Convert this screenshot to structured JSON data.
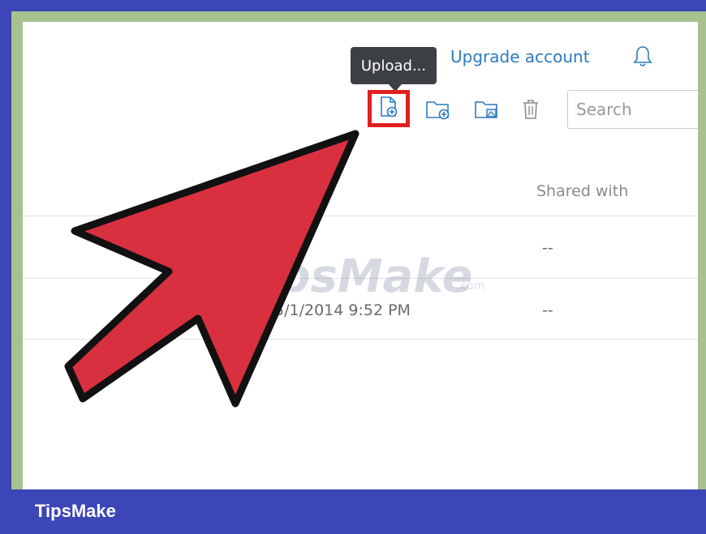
{
  "header": {
    "upgrade_link": "Upgrade account",
    "tooltip": "Upload..."
  },
  "toolbar": {
    "icons": [
      "upload-file-icon",
      "new-folder-icon",
      "upload-folder-icon",
      "trash-icon"
    ],
    "search_placeholder": "Search"
  },
  "table": {
    "columns": [
      "Shared with"
    ],
    "rows": [
      {
        "modified": "",
        "shared_with": "--"
      },
      {
        "modified": "5/1/2014 9:52 PM",
        "shared_with": "--"
      }
    ]
  },
  "watermark": {
    "text": "TipsMake",
    "suffix": ".com"
  },
  "footer": {
    "brand": "TipsMake"
  },
  "colors": {
    "frame": "#3d46b6",
    "inner_frame": "#a7c28f",
    "link": "#2c7bbf",
    "highlight": "#e02020",
    "arrow_fill": "#d93040"
  }
}
